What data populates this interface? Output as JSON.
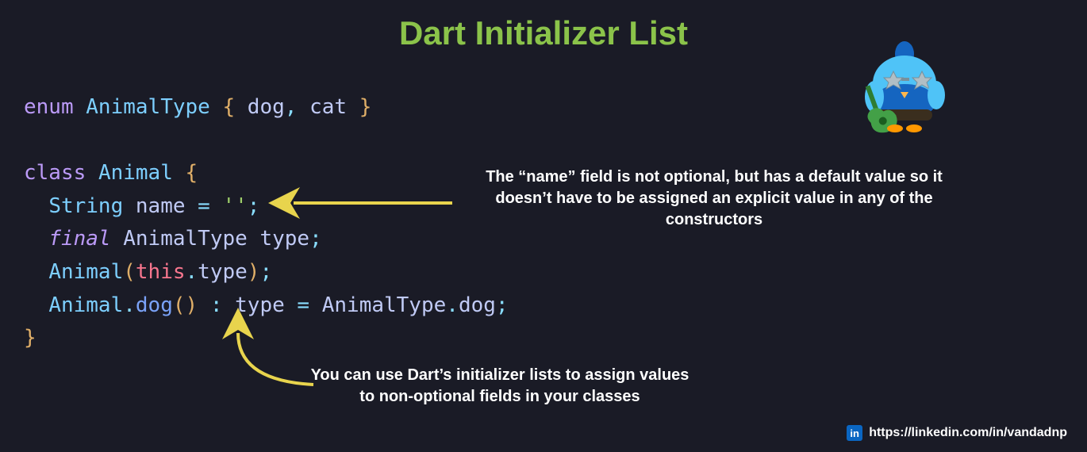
{
  "title": "Dart Initializer List",
  "code": {
    "l1": {
      "enum": "enum",
      "sp1": " ",
      "AnimalType": "AnimalType",
      "sp2": " ",
      "ob": "{",
      "sp3": " ",
      "dog": "dog",
      "c1": ",",
      "sp4": " ",
      "cat": "cat",
      "sp5": " ",
      "cb": "}"
    },
    "l3": {
      "class": "class",
      "sp1": " ",
      "Animal": "Animal",
      "sp2": " ",
      "ob": "{"
    },
    "l4": {
      "indent": "  ",
      "String": "String",
      "sp1": " ",
      "name": "name",
      "sp2": " ",
      "eq": "=",
      "sp3": " ",
      "str": "''",
      "sc": ";"
    },
    "l5": {
      "indent": "  ",
      "final": "final",
      "sp1": " ",
      "AnimalType": "AnimalType",
      "sp2": " ",
      "type": "type",
      "sc": ";"
    },
    "l6": {
      "indent": "  ",
      "Animal": "Animal",
      "op": "(",
      "this": "this",
      "dot": ".",
      "type": "type",
      "cp": ")",
      "sc": ";"
    },
    "l7": {
      "indent": "  ",
      "Animal": "Animal",
      "dot": ".",
      "dog": "dog",
      "op": "(",
      "cp": ")",
      "sp1": " ",
      "colon": ":",
      "sp2": " ",
      "type": "type",
      "sp3": " ",
      "eq": "=",
      "sp4": " ",
      "AnimalType": "AnimalType",
      "dot2": ".",
      "dogv": "dog",
      "sc": ";"
    },
    "l8": {
      "cb": "}"
    }
  },
  "annotations": {
    "a1": "The “name” field is not optional, but has a default value so it doesn’t have to be assigned an explicit value in any of the constructors",
    "a2": "You can use Dart’s initializer lists to assign values to non-optional fields in your classes"
  },
  "footer": {
    "url": "https://linkedin.com/in/vandadnp",
    "icon": "in"
  },
  "colors": {
    "bg": "#1a1b26",
    "title": "#8bc34a",
    "arrow": "#e8d44d"
  }
}
